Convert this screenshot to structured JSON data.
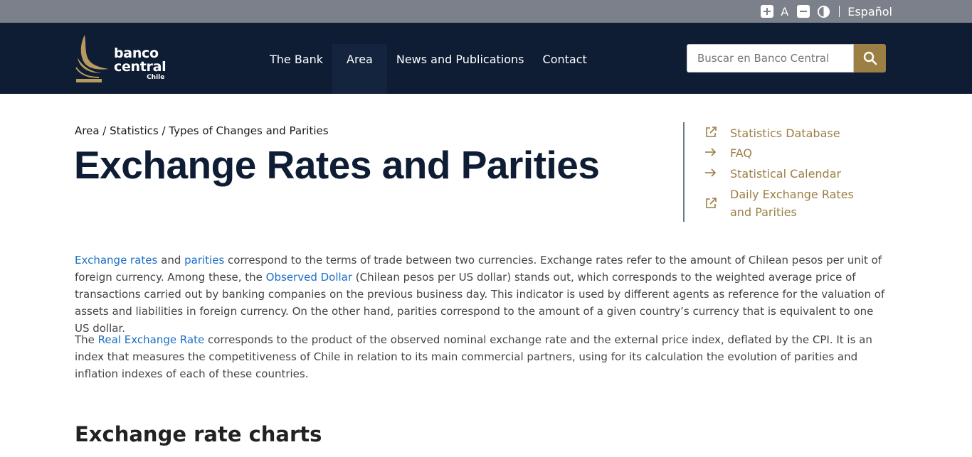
{
  "utility": {
    "font_size_label": "A",
    "language_label": "Español"
  },
  "header": {
    "logo": {
      "line1": "banco",
      "line2": "central",
      "line3": "Chile"
    },
    "nav": [
      {
        "label": "The Bank"
      },
      {
        "label": "Area"
      },
      {
        "label": "News and Publications"
      },
      {
        "label": "Contact"
      }
    ],
    "search_placeholder": "Buscar en Banco Central"
  },
  "breadcrumb": {
    "items": [
      "Area",
      "Statistics",
      "Types of Changes and Parities"
    ],
    "separator": " / "
  },
  "page_title": "Exchange Rates and Parities",
  "side_links": [
    {
      "label": "Statistics Database",
      "icon": "external-link-icon"
    },
    {
      "label": "FAQ",
      "icon": "arrow-right-icon"
    },
    {
      "label": "Statistical Calendar",
      "icon": "arrow-right-icon"
    },
    {
      "label": "Daily Exchange Rates and Parities",
      "icon": "external-link-icon"
    }
  ],
  "paragraph1": {
    "link_exchange_rates": "Exchange rates",
    "and": " and ",
    "link_parities": "parities",
    "text1": " correspond to the terms of trade between two currencies. Exchange rates refer to the amount of Chilean pesos per unit of foreign currency. Among these, the ",
    "link_observed_dollar": "Observed Dollar",
    "text2": " (Chilean pesos per US dollar) stands out, which corresponds to the weighted average price of transactions carried out by banking companies on the previous business day. This indicator is used by different agents as reference for the valuation of assets and liabilities in foreign currency. On the other hand, parities correspond to the amount of a given country’s currency that is equivalent to one US dollar."
  },
  "paragraph2": {
    "text_before": "The ",
    "link_real_exchange_rate": "Real Exchange Rate",
    "text_after": " corresponds to the product of the observed nominal exchange rate and the external price index, deflated by the CPI. It is an index that measures the competitiveness of Chile in relation to its main commercial partners, using for its calculation the evolution of parities and inflation indexes of each of these countries."
  },
  "section_title": "Exchange rate charts",
  "colors": {
    "header_bg": "#0e1c34",
    "utility_bg": "#7c808b",
    "accent_gold": "#9b7f45",
    "link_blue": "#1a6fc4"
  }
}
